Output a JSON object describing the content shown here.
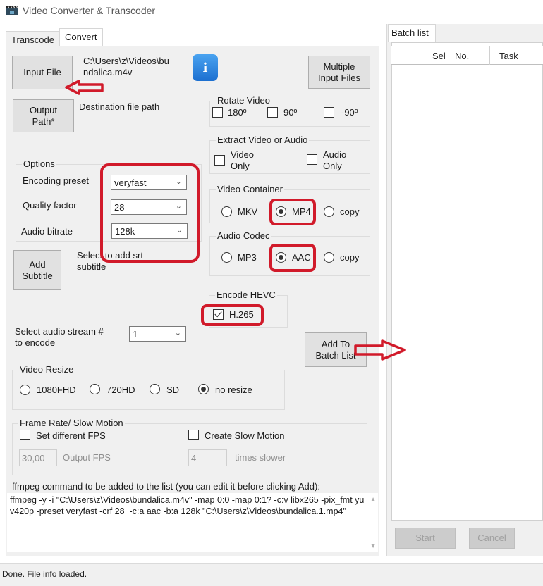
{
  "window": {
    "title": "Video Converter & Transcoder",
    "icon": "clapperboard-icon"
  },
  "tabs": [
    {
      "label": "Transcode",
      "active": false
    },
    {
      "label": "Convert",
      "active": true
    }
  ],
  "input": {
    "input_file_button": "Input File",
    "input_path": "C:\\Users\\z\\Videos\\bundalica.m4v",
    "input_path_line1": "C:\\Users\\z\\Videos\\bu",
    "input_path_line2": "ndalica.m4v",
    "info_button": "i",
    "multiple_files_line1": "Multiple",
    "multiple_files_line2": "Input Files",
    "output_path_line1": "Output",
    "output_path_line2": "Path*",
    "destination_label": "Destination file path"
  },
  "rotate": {
    "title": "Rotate Video",
    "options": [
      {
        "label": "180º",
        "checked": false
      },
      {
        "label": "90º",
        "checked": false
      },
      {
        "label": "-90º",
        "checked": false
      }
    ]
  },
  "extract": {
    "title": "Extract Video or Audio",
    "video_only_line1": "Video",
    "video_only_line2": "Only",
    "video_only_checked": false,
    "audio_only_line1": "Audio",
    "audio_only_line2": "Only",
    "audio_only_checked": false
  },
  "options": {
    "title": "Options",
    "encoding_preset_label": "Encoding preset",
    "encoding_preset_value": "veryfast",
    "quality_factor_label": "Quality factor",
    "quality_factor_value": "28",
    "audio_bitrate_label": "Audio bitrate",
    "audio_bitrate_value": "128k"
  },
  "video_container": {
    "title": "Video Container",
    "options": [
      {
        "label": "MKV",
        "selected": false
      },
      {
        "label": "MP4",
        "selected": true
      },
      {
        "label": "copy",
        "selected": false
      }
    ]
  },
  "audio_codec": {
    "title": "Audio Codec",
    "options": [
      {
        "label": "MP3",
        "selected": false
      },
      {
        "label": "AAC",
        "selected": true
      },
      {
        "label": "copy",
        "selected": false
      }
    ]
  },
  "subtitle": {
    "button_line1": "Add",
    "button_line2": "Subtitle",
    "hint_line1": "Select to add srt",
    "hint_line2": "subtitle"
  },
  "hevc": {
    "title": "Encode HEVC",
    "label": "H.265",
    "checked": true
  },
  "audio_stream": {
    "label_line1": "Select audio stream #",
    "label_line2": "to encode",
    "value": "1"
  },
  "add_batch": {
    "line1": "Add To",
    "line2": "Batch List"
  },
  "resize": {
    "title": "Video Resize",
    "options": [
      {
        "label": "1080FHD",
        "selected": false
      },
      {
        "label": "720HD",
        "selected": false
      },
      {
        "label": "SD",
        "selected": false
      },
      {
        "label": "no resize",
        "selected": true
      }
    ]
  },
  "frame_rate": {
    "title": "Frame Rate/ Slow Motion",
    "set_fps_label": "Set different FPS",
    "set_fps_checked": false,
    "slow_motion_label": "Create Slow Motion",
    "slow_motion_checked": false,
    "fps_value": "30,00",
    "fps_hint": "Output FPS",
    "slower_value": "4",
    "slower_hint": "times slower"
  },
  "command": {
    "label": "ffmpeg command to be added to the list (you can edit it before clicking Add):",
    "text": "ffmpeg -y -i \"C:\\Users\\z\\Videos\\bundalica.m4v\" -map 0:0 -map 0:1? -c:v libx265 -pix_fmt yuv420p -preset veryfast -crf 28  -c:a aac -b:a 128k \"C:\\Users\\z\\Videos\\bundalica.1.mp4\""
  },
  "batch_list": {
    "tab_label": "Batch list",
    "columns": [
      "",
      "Sel",
      "No.",
      "Task"
    ],
    "rows": [],
    "start_button": "Start",
    "cancel_button": "Cancel"
  },
  "status": {
    "text": "Done. File info loaded."
  },
  "colors": {
    "annotation_red": "#d11a2a",
    "panel_bg": "#f0f0f0",
    "info_blue": "#1c6fd0"
  }
}
